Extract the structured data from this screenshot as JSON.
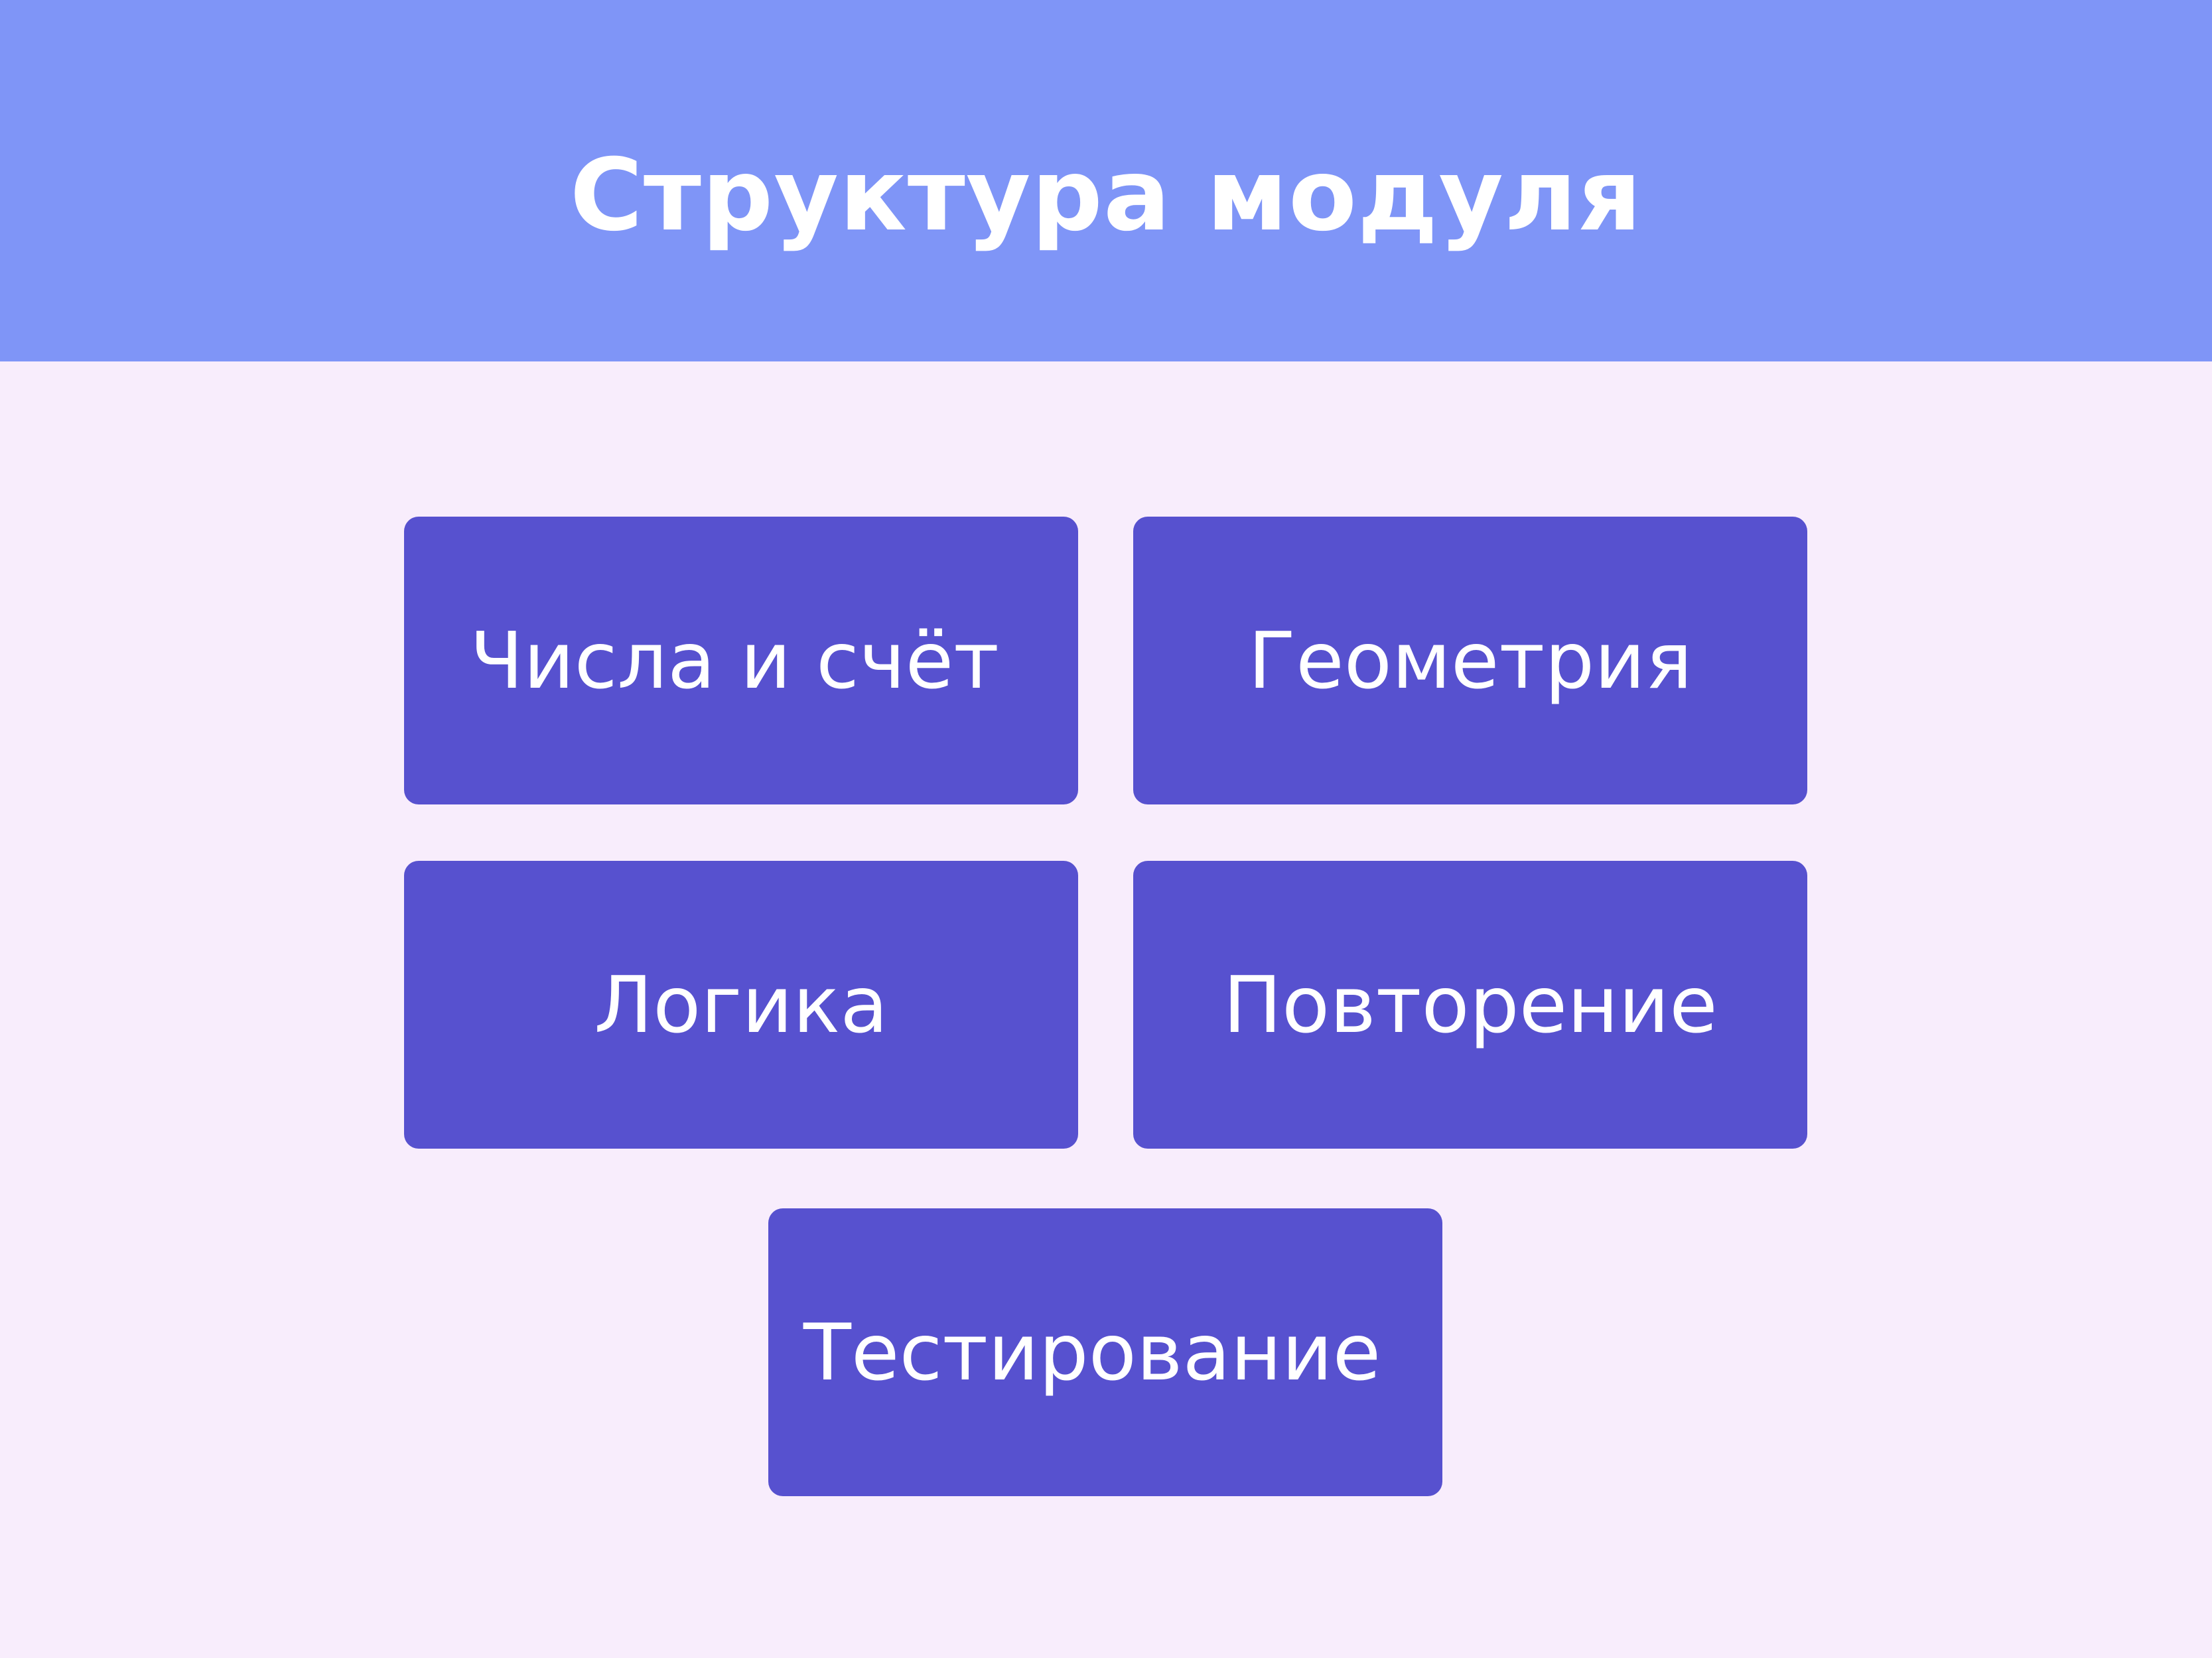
{
  "title": "Структура модуля",
  "colors": {
    "header": "#7F95F7",
    "background": "#F8EDFC",
    "box": "#5751CF",
    "text": "#FFFFFF"
  },
  "boxes": [
    {
      "label": "Числа и счёт"
    },
    {
      "label": "Геометрия"
    },
    {
      "label": "Логика"
    },
    {
      "label": "Повторение"
    },
    {
      "label": "Тестирование"
    }
  ]
}
